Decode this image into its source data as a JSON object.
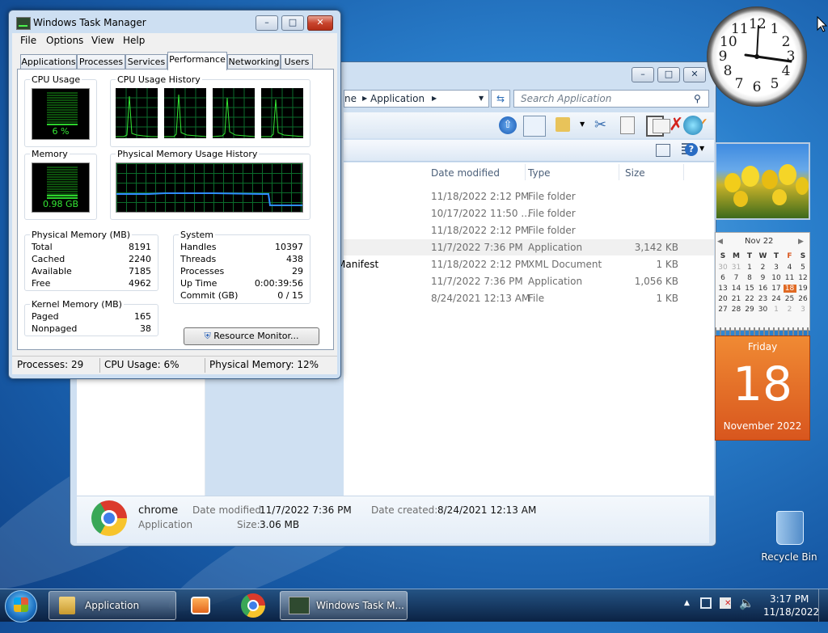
{
  "task_manager": {
    "title": "Windows Task Manager",
    "menu": [
      "File",
      "Options",
      "View",
      "Help"
    ],
    "tabs": [
      "Applications",
      "Processes",
      "Services",
      "Performance",
      "Networking",
      "Users"
    ],
    "active_tab": "Performance",
    "groups": {
      "cpu_usage": "CPU Usage",
      "cpu_history": "CPU Usage History",
      "memory": "Memory",
      "phys_mem_history": "Physical Memory Usage History",
      "physical_memory": "Physical Memory (MB)",
      "system": "System",
      "kernel_memory": "Kernel Memory (MB)"
    },
    "cpu_value": "6 %",
    "cpu_fraction": 0.06,
    "memory_value": "0.98 GB",
    "memory_fraction": 0.12,
    "physical_memory": [
      {
        "label": "Total",
        "value": "8191"
      },
      {
        "label": "Cached",
        "value": "2240"
      },
      {
        "label": "Available",
        "value": "7185"
      },
      {
        "label": "Free",
        "value": "4962"
      }
    ],
    "system": [
      {
        "label": "Handles",
        "value": "10397"
      },
      {
        "label": "Threads",
        "value": "438"
      },
      {
        "label": "Processes",
        "value": "29"
      },
      {
        "label": "Up Time",
        "value": "0:00:39:56"
      },
      {
        "label": "Commit (GB)",
        "value": "0 / 15"
      }
    ],
    "kernel_memory": [
      {
        "label": "Paged",
        "value": "165"
      },
      {
        "label": "Nonpaged",
        "value": "38"
      }
    ],
    "resource_monitor_label": "Resource Monitor...",
    "status": {
      "processes": "Processes: 29",
      "cpu": "CPU Usage: 6%",
      "memory": "Physical Memory: 12%"
    }
  },
  "explorer": {
    "address_parts": [
      "ne",
      "Application"
    ],
    "search_placeholder": "Search Application",
    "columns": [
      "Date modified",
      "Type",
      "Size"
    ],
    "rows": [
      {
        "name": "",
        "date": "11/18/2022 2:12 PM",
        "type": "File folder",
        "size": ""
      },
      {
        "name": "",
        "date": "10/17/2022 11:50 ...",
        "type": "File folder",
        "size": ""
      },
      {
        "name": "",
        "date": "11/18/2022 2:12 PM",
        "type": "File folder",
        "size": ""
      },
      {
        "name": "",
        "date": "11/7/2022 7:36 PM",
        "type": "Application",
        "size": "3,142 KB"
      },
      {
        "name": "Manifest",
        "date": "11/18/2022 2:12 PM",
        "type": "XML Document",
        "size": "1 KB"
      },
      {
        "name": "",
        "date": "11/7/2022 7:36 PM",
        "type": "Application",
        "size": "1,056 KB"
      },
      {
        "name": "",
        "date": "8/24/2021 12:13 AM",
        "type": "File",
        "size": "1 KB"
      }
    ],
    "details": {
      "name": "chrome",
      "kind": "Application",
      "date_modified_label": "Date modified:",
      "date_modified": "11/7/2022 7:36 PM",
      "size_label": "Size:",
      "size": "3.06 MB",
      "date_created_label": "Date created:",
      "date_created": "8/24/2021 12:13 AM"
    }
  },
  "gadgets": {
    "clock_numbers": [
      "12",
      "1",
      "2",
      "3",
      "4",
      "5",
      "6",
      "7",
      "8",
      "9",
      "10",
      "11"
    ],
    "calendar": {
      "month_short": "Nov 22",
      "weekday_letters": [
        "S",
        "M",
        "T",
        "W",
        "T",
        "F",
        "S"
      ],
      "weeks": [
        [
          "30",
          "31",
          "1",
          "2",
          "3",
          "4",
          "5"
        ],
        [
          "6",
          "7",
          "8",
          "9",
          "10",
          "11",
          "12"
        ],
        [
          "13",
          "14",
          "15",
          "16",
          "17",
          "18",
          "19"
        ],
        [
          "20",
          "21",
          "22",
          "23",
          "24",
          "25",
          "26"
        ],
        [
          "27",
          "28",
          "29",
          "30",
          "1",
          "2",
          "3"
        ]
      ],
      "weekday": "Friday",
      "day": "18",
      "month_year": "November 2022"
    }
  },
  "desktop": {
    "recycle_bin_label": "Recycle Bin"
  },
  "taskbar": {
    "explorer_button": "Application",
    "taskmgr_button": "Windows Task M...",
    "time": "3:17 PM",
    "date": "11/18/2022"
  },
  "colors": {
    "accent": "#2a7fcc",
    "graph_green": "#34e834",
    "memory_line": "#2f8cff",
    "calendar_orange": "#e06a24"
  }
}
